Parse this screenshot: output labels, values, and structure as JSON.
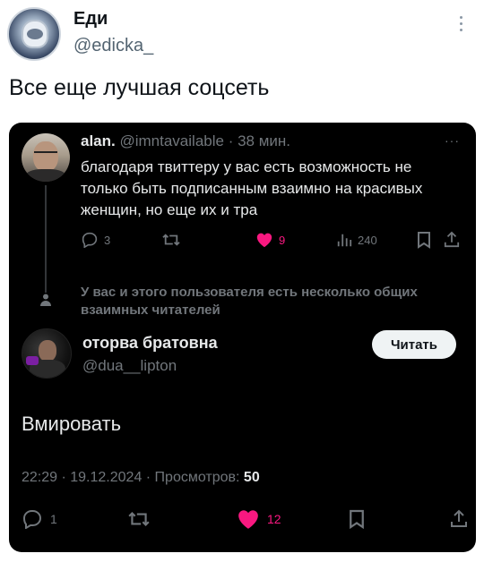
{
  "outer": {
    "author_name": "Еди",
    "author_handle": "@edicka_",
    "text": "Все еще лучшая соцсеть"
  },
  "quoted": {
    "name": "alan.",
    "handle": "@imntavailable",
    "time": "· 38 мин.",
    "more": "···",
    "text": "благодаря твиттеру у вас есть возможность не только быть подписанным взаимно на красивых женщин, но еще их и тра",
    "replies": "3",
    "likes": "9",
    "views": "240"
  },
  "common_followers": "У вас и этого пользователя есть несколько общих взаимных читателей",
  "reply": {
    "name": "оторва братовна",
    "handle": "@dua__lipton",
    "follow_label": "Читать",
    "text": "Вмировать",
    "timestamp": "22:29 · 19.12.2024 · Просмотров: ",
    "views": "50",
    "replies": "1",
    "likes": "12"
  },
  "colors": {
    "like": "#f91880",
    "muted": "#71767b",
    "card_bg": "#000000"
  }
}
